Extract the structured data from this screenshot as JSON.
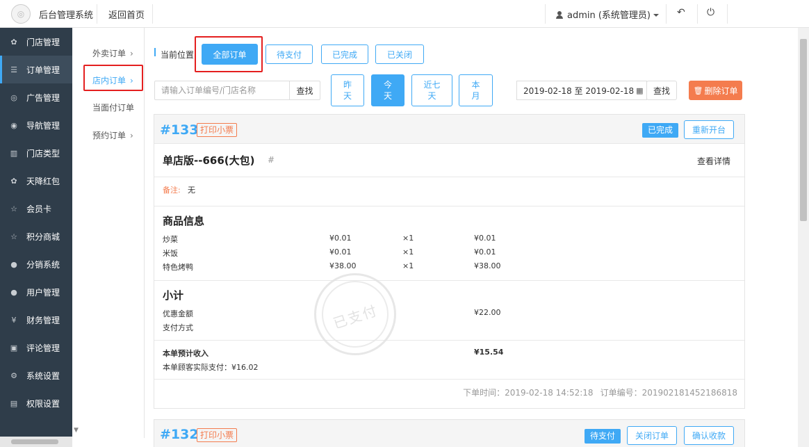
{
  "topbar": {
    "app_title": "后台管理系统",
    "back_home": "返回首页",
    "user": "admin (系统管理员)",
    "back_icon": "undo-icon",
    "power_icon": "power-icon"
  },
  "sidebar": {
    "items": [
      {
        "label": "门店管理",
        "icon": "store-icon"
      },
      {
        "label": "订单管理",
        "icon": "list-icon"
      },
      {
        "label": "广告管理",
        "icon": "lifebuoy-icon"
      },
      {
        "label": "导航管理",
        "icon": "compass-icon"
      },
      {
        "label": "门店类型",
        "icon": "bank-icon"
      },
      {
        "label": "天降红包",
        "icon": "cubes-icon"
      },
      {
        "label": "会员卡",
        "icon": "star-icon"
      },
      {
        "label": "积分商城",
        "icon": "star-icon"
      },
      {
        "label": "分销系统",
        "icon": "users-icon"
      },
      {
        "label": "用户管理",
        "icon": "user-icon"
      },
      {
        "label": "财务管理",
        "icon": "yen-icon"
      },
      {
        "label": "评论管理",
        "icon": "comment-icon"
      },
      {
        "label": "系统设置",
        "icon": "gear-icon"
      },
      {
        "label": "权限设置",
        "icon": "lock-icon"
      }
    ]
  },
  "subnav": {
    "items": [
      {
        "label": "外卖订单",
        "chevron": "›"
      },
      {
        "label": "店内订单",
        "chevron": "›"
      },
      {
        "label": "当面付订单",
        "chevron": ""
      },
      {
        "label": "预约订单",
        "chevron": "›"
      }
    ]
  },
  "toolbar": {
    "crumb": "当前位置",
    "tabs": [
      "全部订单",
      "待支付",
      "已完成",
      "已关闭"
    ],
    "search_placeholder": "请输入订单编号/门店名称",
    "search_btn": "查找",
    "range_buttons": [
      "昨天",
      "今天",
      "近七天",
      "本月"
    ],
    "date_range": "2019-02-18 至 2019-02-18",
    "date_search_btn": "查找",
    "delete_btn": "删除订单",
    "accent_color": "#3fa9f5",
    "danger_color": "#f47c4e"
  },
  "orders": [
    {
      "number": "#133",
      "print": "打印小票",
      "status": "已完成",
      "action": "重新开台",
      "store": "单店版--666(大包)",
      "hash": "#",
      "detail_link": "查看详情",
      "remark_label": "备注:",
      "remark": "无",
      "goods_title": "商品信息",
      "goods": [
        {
          "name": "炒菜",
          "price": "¥0.01",
          "qty": "×1",
          "total": "¥0.01"
        },
        {
          "name": "米饭",
          "price": "¥0.01",
          "qty": "×1",
          "total": "¥0.01"
        },
        {
          "name": "特色烤鸭",
          "price": "¥38.00",
          "qty": "×1",
          "total": "¥38.00"
        }
      ],
      "subtotal_title": "小计",
      "discount_label": "优惠金额",
      "discount": "¥22.00",
      "pay_method_label": "支付方式",
      "income_label": "本单预计收入",
      "income": "¥15.54",
      "paid_text": "本单顾客实际支付：¥16.02",
      "order_time": "下单时间：2019-02-18 14:52:18",
      "order_id": "订单编号：20190218145218681​8",
      "stamp": "已支付"
    },
    {
      "number": "#132",
      "print": "打印小票",
      "status": "待支付",
      "actions": [
        "关闭订单",
        "确认收款"
      ]
    }
  ]
}
